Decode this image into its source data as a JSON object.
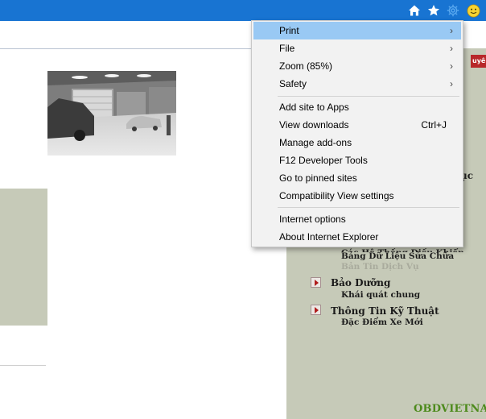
{
  "browser": {
    "toolbar_icons": [
      "home-icon",
      "favorites-star-icon",
      "tools-gear-icon",
      "feedback-smiley-icon"
    ]
  },
  "tools_menu": {
    "groups": [
      [
        {
          "label": "Print",
          "has_submenu": true,
          "highlighted": true
        },
        {
          "label": "File",
          "has_submenu": true
        },
        {
          "label": "Zoom (85%)",
          "has_submenu": true
        },
        {
          "label": "Safety",
          "has_submenu": true
        }
      ],
      [
        {
          "label": "Add site to Apps"
        },
        {
          "label": "View downloads",
          "shortcut": "Ctrl+J"
        },
        {
          "label": "Manage add-ons"
        },
        {
          "label": "F12 Developer Tools"
        },
        {
          "label": "Go to pinned sites"
        },
        {
          "label": "Compatibility View settings"
        }
      ],
      [
        {
          "label": "Internet options"
        },
        {
          "label": "About Internet Explorer"
        }
      ]
    ],
    "submenu_glyph": "›",
    "highlight_color": "#99c9f4"
  },
  "page": {
    "red_tag_text": "uyên",
    "cut_text": "ục",
    "links": {
      "clipped_top": "Các Hệ Thống Điều Khiển",
      "bang_du_lieu": "Bảng Dữ Liệu Sửa Chữa",
      "ban_tin": "Bản Tin Dịch Vụ"
    },
    "sections": [
      {
        "title": "Bảo Dưỡng",
        "sub": "Khái quát chung"
      },
      {
        "title": "Thông Tin Kỹ Thuật",
        "sub": "Đặc Điểm Xe Mới"
      }
    ],
    "watermark": "OBDVIETNAM",
    "colors": {
      "titlebar": "#1874d2",
      "panel": "#c6cab8",
      "watermark": "#4d8a1c"
    }
  }
}
